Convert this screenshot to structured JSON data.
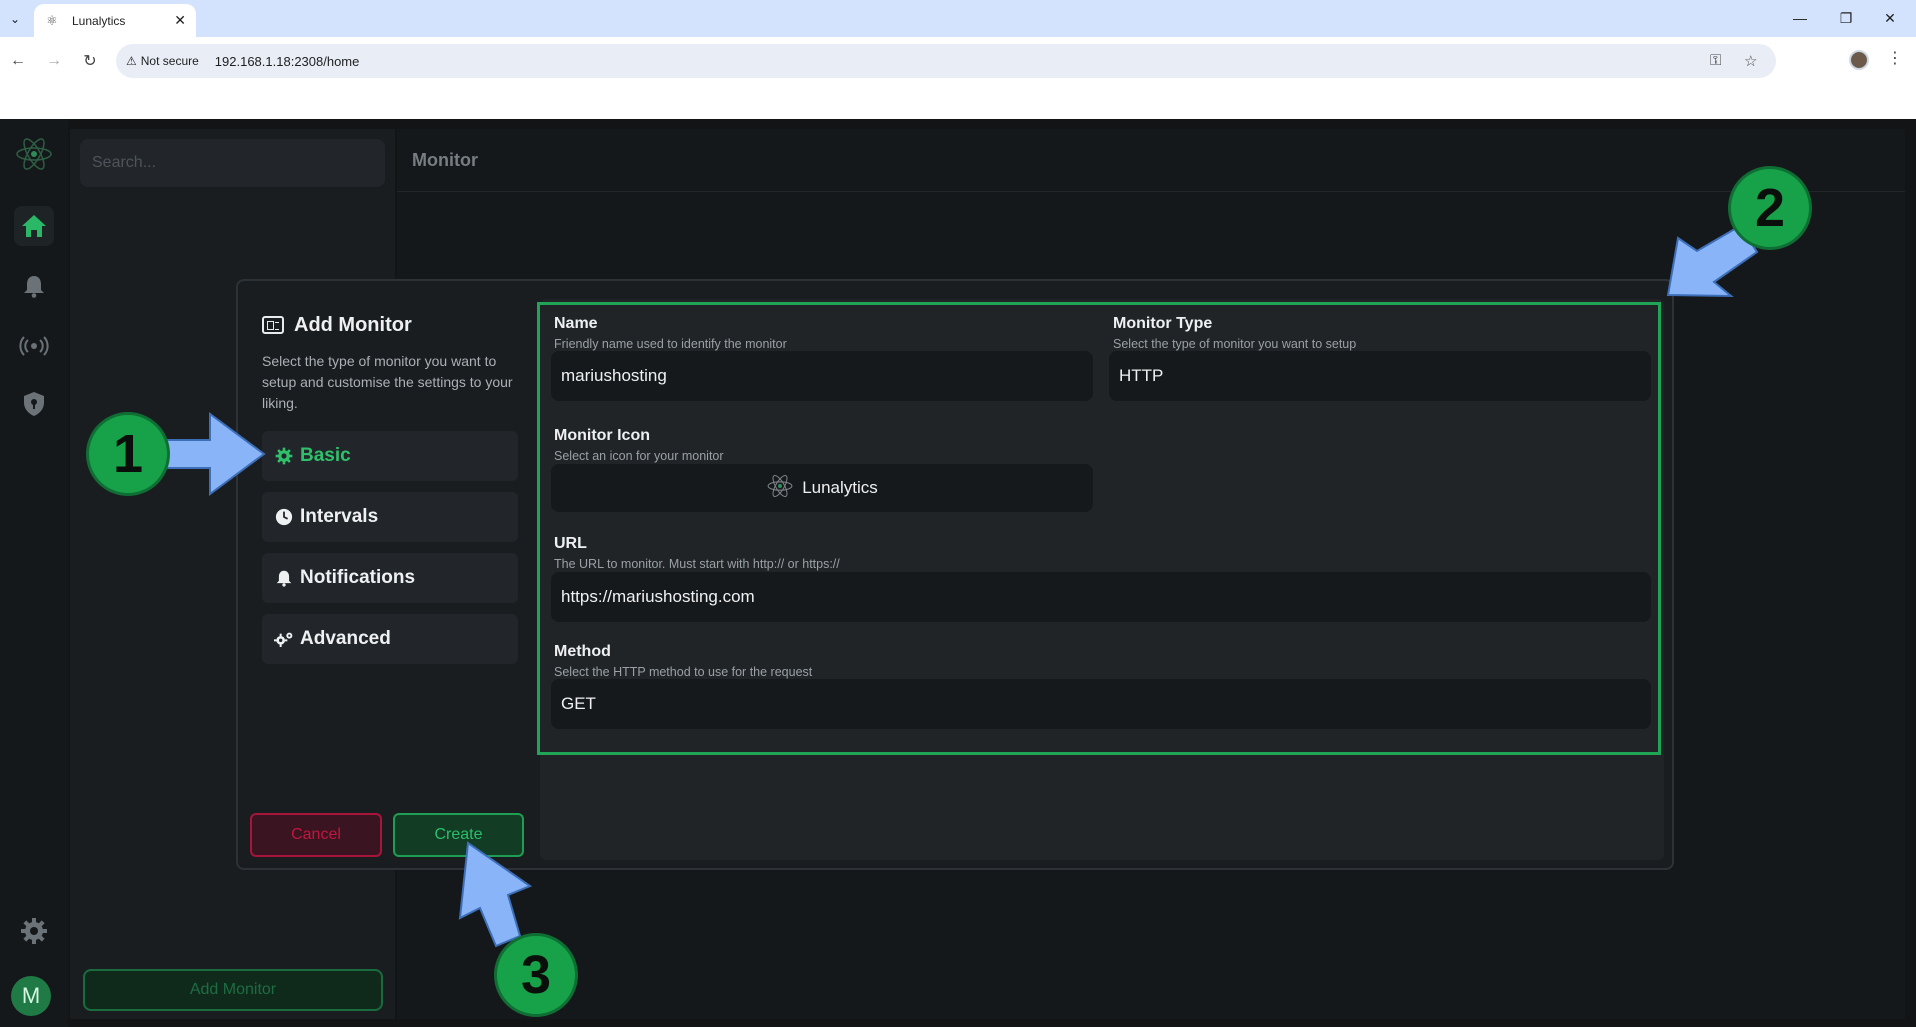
{
  "browser": {
    "tab_title": "Lunalytics",
    "tab_close": "✕",
    "security_label": "Not secure",
    "url": "192.168.1.18:2308/home"
  },
  "sidebar": {
    "search_placeholder": "Search...",
    "add_monitor_label": "Add Monitor",
    "avatar_initial": "M"
  },
  "content": {
    "title": "Monitor"
  },
  "modal": {
    "title": "Add Monitor",
    "description": "Select the type of monitor you want to setup and customise the settings to your liking.",
    "nav": [
      {
        "label": "Basic",
        "active": true
      },
      {
        "label": "Intervals",
        "active": false
      },
      {
        "label": "Notifications",
        "active": false
      },
      {
        "label": "Advanced",
        "active": false
      }
    ],
    "cancel_label": "Cancel",
    "create_label": "Create",
    "fields": {
      "name": {
        "label": "Name",
        "hint": "Friendly name used to identify the monitor",
        "value": "mariushosting"
      },
      "type": {
        "label": "Monitor Type",
        "hint": "Select the type of monitor you want to setup",
        "value": "HTTP"
      },
      "icon": {
        "label": "Monitor Icon",
        "hint": "Select an icon for your monitor",
        "value": "Lunalytics"
      },
      "url": {
        "label": "URL",
        "hint": "The URL to monitor. Must start with http:// or https://",
        "value": "https://mariushosting.com"
      },
      "method": {
        "label": "Method",
        "hint": "Select the HTTP method to use for the request",
        "value": "GET"
      }
    }
  },
  "callouts": [
    "1",
    "2",
    "3"
  ],
  "colors": {
    "accent_green": "#2ec06a",
    "callout_green": "#17a24a",
    "arrow_blue": "#8ab4f8",
    "danger": "#c1173f"
  }
}
